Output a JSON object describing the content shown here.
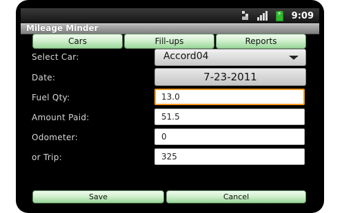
{
  "status_bar": {
    "time": "9:09",
    "network_icon": "3g-icon",
    "signal_icon": "signal-icon",
    "battery_icon": "battery-charging-icon"
  },
  "app": {
    "title": "Mileage Minder"
  },
  "nav": {
    "cars_label": "Cars",
    "fillups_label": "Fill-ups",
    "reports_label": "Reports"
  },
  "form": {
    "select_car_label": "Select Car:",
    "select_car_value": "Accord04",
    "date_label": "Date:",
    "date_value": "7-23-2011",
    "fuel_qty_label": "Fuel Qty:",
    "fuel_qty_value": "13.0",
    "amount_paid_label": "Amount Paid:",
    "amount_paid_value": "51.5",
    "odometer_label": "Odometer:",
    "odometer_value": "0",
    "trip_label": "or Trip:",
    "trip_value": "325"
  },
  "actions": {
    "save_label": "Save",
    "cancel_label": "Cancel"
  },
  "colors": {
    "button_green": "#c8eec5",
    "focus_orange": "#ff9a20",
    "background": "#000000"
  }
}
